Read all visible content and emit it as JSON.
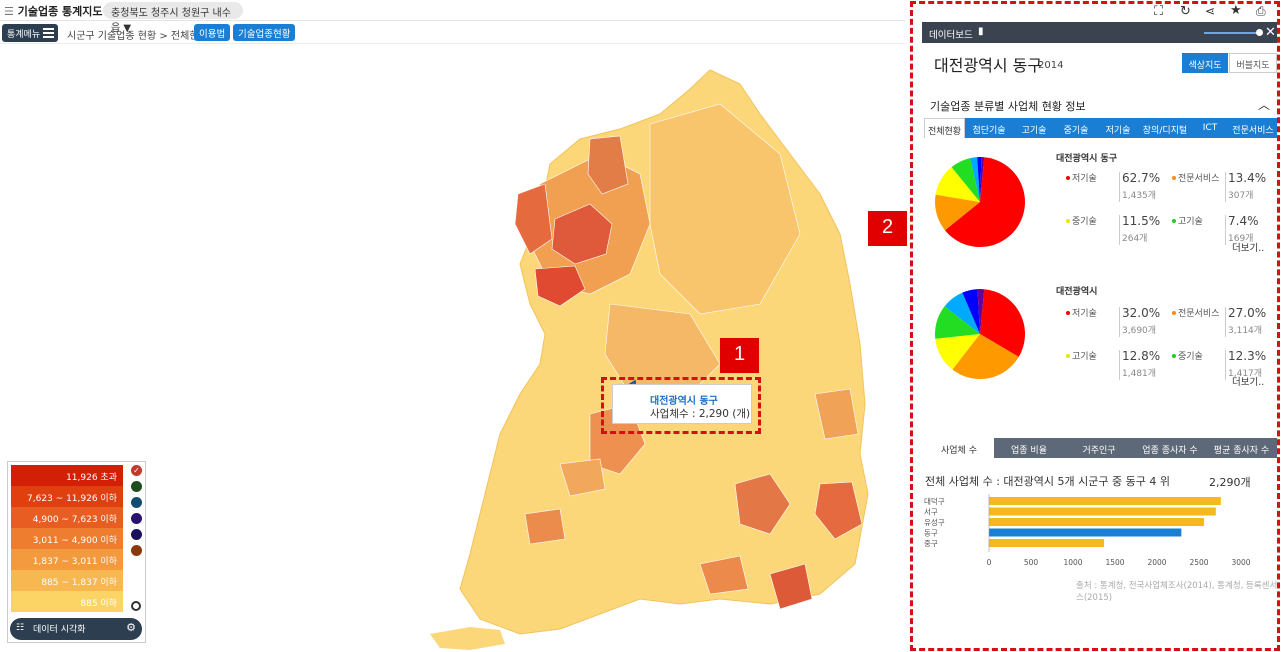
{
  "app": {
    "title": "기술업종 통계지도",
    "location": "충청북도 청주시 청원구 내수읍"
  },
  "nav": {
    "menu_label": "통계메뉴",
    "breadcrumb": "시군구 기술업종 현황 > 전체현황",
    "btn_guide": "이용법",
    "btn_status": "기술업종현황"
  },
  "tooltip": {
    "name": "대전광역시 동구",
    "value": "사업체수 : 2,290 (개)"
  },
  "markers": {
    "m1": "1",
    "m2": "2"
  },
  "legend": {
    "items": [
      {
        "label": "11,926 초과",
        "color": "#d21f06"
      },
      {
        "label": "7,623 ~ 11,926 이하",
        "color": "#e03f10"
      },
      {
        "label": "4,900 ~ 7,623 이하",
        "color": "#e85e22"
      },
      {
        "label": "3,011 ~ 4,900 이하",
        "color": "#ee7d2f"
      },
      {
        "label": "1,837 ~ 3,011 이하",
        "color": "#f39a3f"
      },
      {
        "label": "885 ~ 1,837 이하",
        "color": "#f7b751"
      },
      {
        "label": "885 이하",
        "color": "#fcd465"
      }
    ],
    "dots": [
      "#c0392b",
      "#1f4d1f",
      "#0f4c6f",
      "#2a1070",
      "#1a1060",
      "#8a3a0a"
    ],
    "viz_button": "데이터 시각화"
  },
  "dashboard": {
    "header": "데이터보드",
    "region": "대전광역시 동구",
    "year": "2014",
    "map_btn_color": "색상지도",
    "map_btn_bubble": "버블지도",
    "section_title": "기술업종 분류별 사업체 현황 정보",
    "categories": [
      "전체현황",
      "첨단기술",
      "고기술",
      "중기술",
      "저기술",
      "창의/디지털",
      "ICT",
      "전문서비스"
    ],
    "block1": {
      "title": "대전광역시 동구",
      "stats": [
        {
          "label": "저기술",
          "pct": "62.7%",
          "count": "1,435개",
          "color": "#ff0000"
        },
        {
          "label": "전문서비스",
          "pct": "13.4%",
          "count": "307개",
          "color": "#ff8c00"
        },
        {
          "label": "중기술",
          "pct": "11.5%",
          "count": "264개",
          "color": "#e8e800"
        },
        {
          "label": "고기술",
          "pct": "7.4%",
          "count": "169개",
          "color": "#22cc22"
        }
      ],
      "more": "더보기.."
    },
    "block2": {
      "title": "대전광역시",
      "stats": [
        {
          "label": "저기술",
          "pct": "32.0%",
          "count": "3,690개",
          "color": "#ff0000"
        },
        {
          "label": "전문서비스",
          "pct": "27.0%",
          "count": "3,114개",
          "color": "#ff8c00"
        },
        {
          "label": "고기술",
          "pct": "12.8%",
          "count": "1,481개",
          "color": "#e8e800"
        },
        {
          "label": "중기술",
          "pct": "12.3%",
          "count": "1,417개",
          "color": "#22cc22"
        }
      ],
      "more": "더보기.."
    },
    "bottom_tabs": [
      "사업체 수",
      "업종 비율",
      "거주인구",
      "업종 종사자 수",
      "평균 종사자 수"
    ],
    "rank_text": "전체 사업체 수 : 대전광역시 5개 시군구 중 동구 4 위",
    "rank_total": "2,290개",
    "source": "출처 : 통계청, 전국사업체조사(2014), 통계청, 등록센서스(2015)"
  },
  "chart_data": [
    {
      "type": "pie",
      "title": "대전광역시 동구",
      "slices": [
        {
          "label": "저기술",
          "value": 62.7,
          "color": "#ff0000"
        },
        {
          "label": "전문서비스",
          "value": 13.4,
          "color": "#ff9900"
        },
        {
          "label": "중기술",
          "value": 11.5,
          "color": "#ffff00"
        },
        {
          "label": "고기술",
          "value": 7.4,
          "color": "#22dd22"
        },
        {
          "label": "창의/디지털",
          "value": 2.5,
          "color": "#00aaff"
        },
        {
          "label": "첨단기술",
          "value": 1.5,
          "color": "#0000ff"
        },
        {
          "label": "ICT",
          "value": 1.0,
          "color": "#660099"
        }
      ]
    },
    {
      "type": "pie",
      "title": "대전광역시",
      "slices": [
        {
          "label": "저기술",
          "value": 32.0,
          "color": "#ff0000"
        },
        {
          "label": "전문서비스",
          "value": 27.0,
          "color": "#ff9900"
        },
        {
          "label": "고기술",
          "value": 12.8,
          "color": "#ffff00"
        },
        {
          "label": "중기술",
          "value": 12.3,
          "color": "#22dd22"
        },
        {
          "label": "창의/디지털",
          "value": 8.0,
          "color": "#00aaff"
        },
        {
          "label": "첨단기술",
          "value": 5.5,
          "color": "#0000ff"
        },
        {
          "label": "ICT",
          "value": 2.4,
          "color": "#660099"
        }
      ]
    },
    {
      "type": "bar",
      "orientation": "horizontal",
      "categories": [
        "대덕구",
        "서구",
        "유성구",
        "동구",
        "중구"
      ],
      "values": [
        2760,
        2700,
        2560,
        2290,
        1370
      ],
      "highlight": "동구",
      "xticks": [
        0,
        500,
        1000,
        1500,
        2000,
        2500,
        3000
      ],
      "xlim": [
        0,
        3000
      ]
    }
  ]
}
